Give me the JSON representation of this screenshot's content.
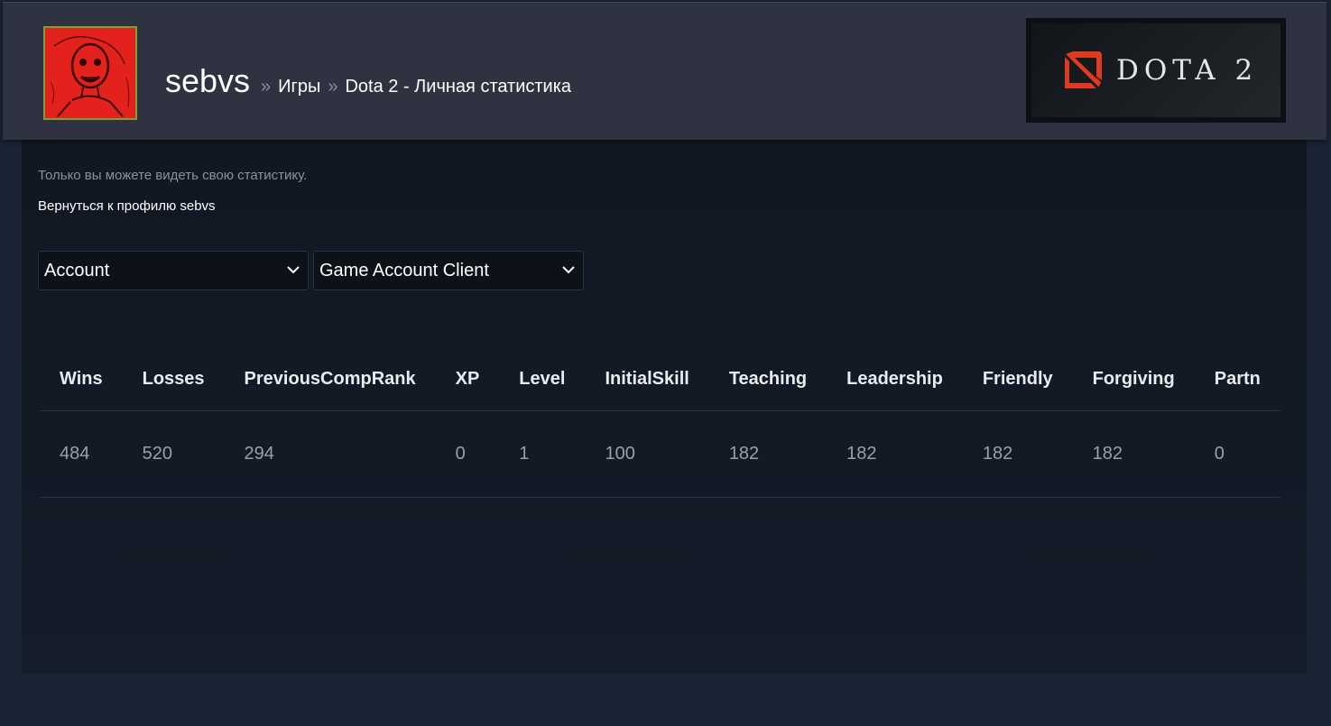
{
  "header": {
    "username": "sebvs",
    "separator": "»",
    "breadcrumb_games": "Игры",
    "breadcrumb_page": "Dota 2 - Личная статистика",
    "game_logo_text": "DOTA 2"
  },
  "privacy_note": "Только вы можете видеть свою статистику.",
  "back_link": "Вернуться к профилю sebvs",
  "selects": {
    "category": "Account",
    "source": "Game Account Client"
  },
  "stats_table": {
    "headers": [
      "Wins",
      "Losses",
      "PreviousCompRank",
      "XP",
      "Level",
      "InitialSkill",
      "Teaching",
      "Leadership",
      "Friendly",
      "Forgiving",
      "Partn"
    ],
    "values": [
      "484",
      "520",
      "294",
      "0",
      "1",
      "100",
      "182",
      "182",
      "182",
      "182",
      "0"
    ]
  },
  "colors": {
    "page_bg": "#1b2434",
    "header_bg": "#2f3341",
    "panel_bg": "#111822",
    "avatar_border": "#7aa136",
    "logo_red": "#e03b1f"
  },
  "icons": {
    "dropdown": "chevron-down-icon",
    "logo": "dota-emblem-icon"
  }
}
